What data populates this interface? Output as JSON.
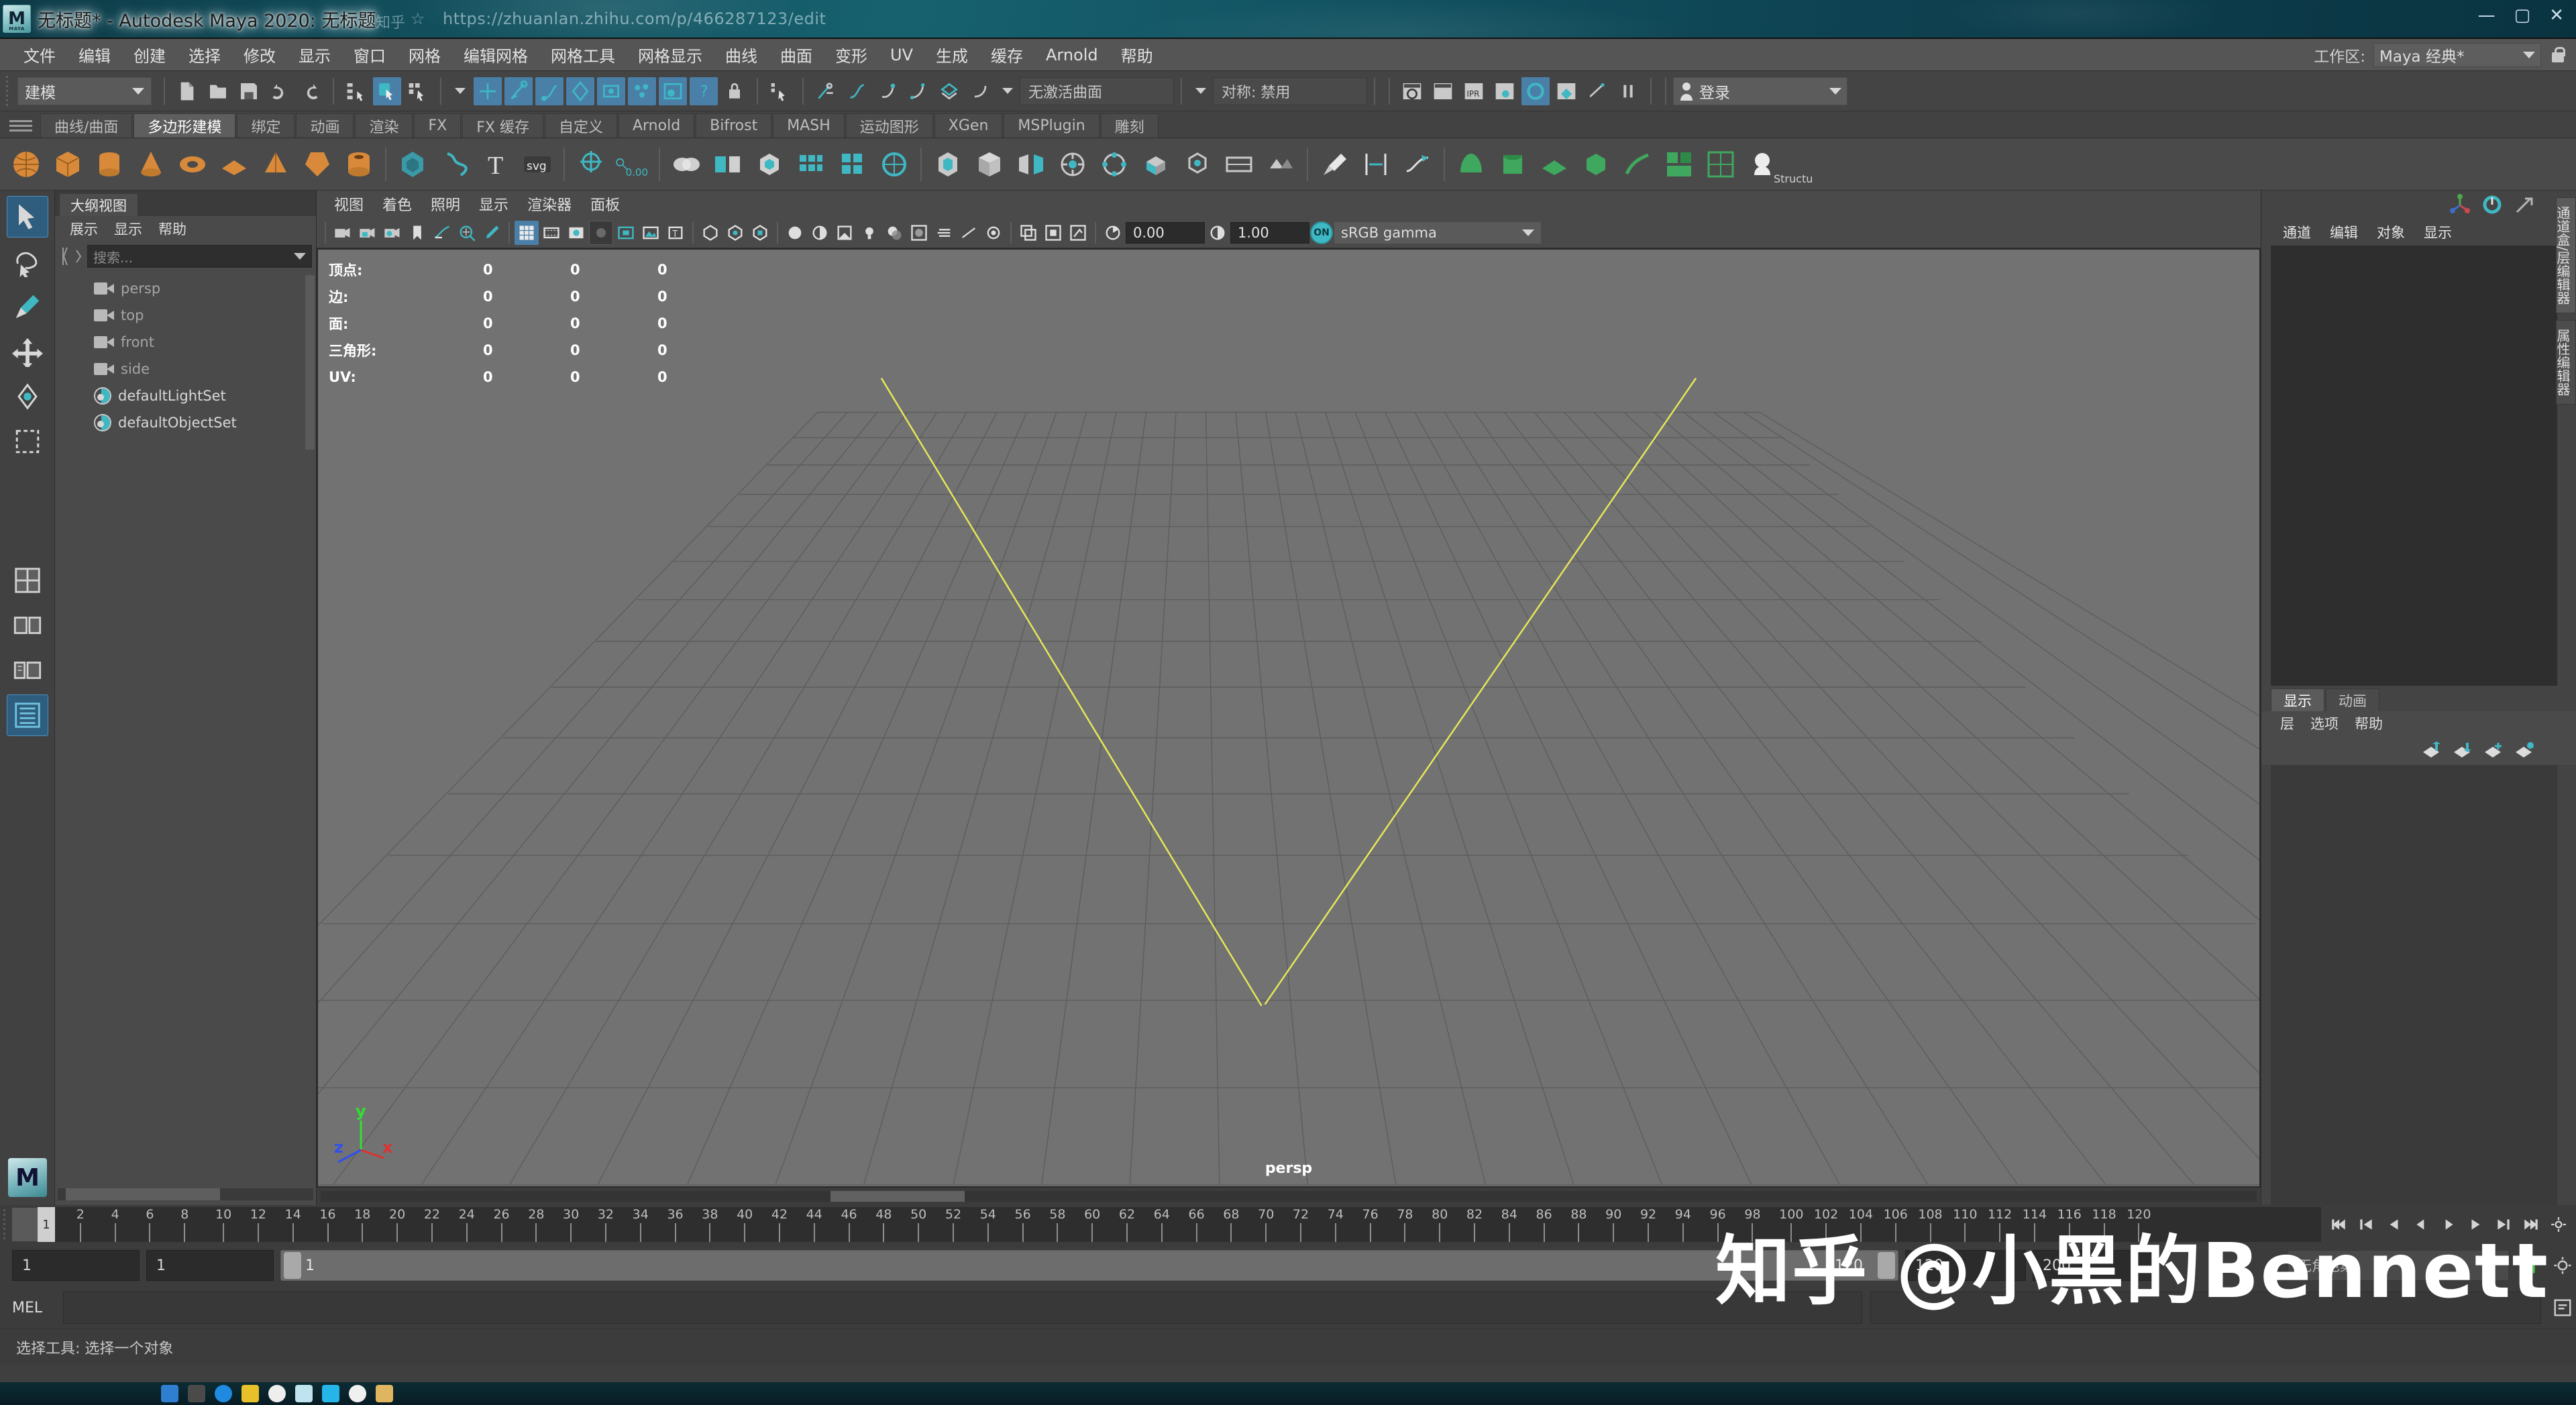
{
  "window": {
    "title": "无标题* - Autodesk Maya 2020: 无标题",
    "logo_text": "M",
    "logo_sub": "MAYA"
  },
  "background_browser": {
    "zhihu_label": "知乎",
    "star_icon": "☆",
    "url": "https://zhuanlan.zhihu.com/p/466287123/edit",
    "minimize": "—",
    "maximize": "▢",
    "close": "✕"
  },
  "menubar": {
    "items": [
      "文件",
      "编辑",
      "创建",
      "选择",
      "修改",
      "显示",
      "窗口",
      "网格",
      "编辑网格",
      "网格工具",
      "网格显示",
      "曲线",
      "曲面",
      "变形",
      "UV",
      "生成",
      "缓存",
      "Arnold",
      "帮助"
    ],
    "workspace_label": "工作区:",
    "workspace_value": "Maya 经典*"
  },
  "statusbar": {
    "mode": "建模",
    "active_surface": "无激活曲面",
    "symmetry": "对称: 禁用",
    "login": "登录"
  },
  "shelf": {
    "tabs": [
      "曲线/曲面",
      "多边形建模",
      "绑定",
      "动画",
      "渲染",
      "FX",
      "FX 缓存",
      "自定义",
      "Arnold",
      "Bifrost",
      "MASH",
      "运动图形",
      "XGen",
      "MSPlugin",
      "雕刻"
    ],
    "active_tab": "多边形建模",
    "text_tool_label": "T",
    "svg_tool_label": "svg",
    "snap_value": "0.00",
    "struct_label": "Structu"
  },
  "outliner": {
    "tab_title": "大纲视图",
    "menus": [
      "展示",
      "显示",
      "帮助"
    ],
    "search_placeholder": "搜索...",
    "items": [
      {
        "name": "persp",
        "type": "camera"
      },
      {
        "name": "top",
        "type": "camera"
      },
      {
        "name": "front",
        "type": "camera"
      },
      {
        "name": "side",
        "type": "camera"
      },
      {
        "name": "defaultLightSet",
        "type": "set"
      },
      {
        "name": "defaultObjectSet",
        "type": "set"
      }
    ]
  },
  "viewport": {
    "menus": [
      "视图",
      "着色",
      "照明",
      "显示",
      "渲染器",
      "面板"
    ],
    "exposure": "0.00",
    "gamma": "1.00",
    "on_badge": "ON",
    "color_space": "sRGB gamma",
    "camera_label": "persp",
    "axis": {
      "x": "x",
      "y": "y",
      "z": "z",
      "x_color": "#e03030",
      "y_color": "#30e030",
      "z_color": "#3050ee"
    },
    "hud": {
      "rows": [
        {
          "label": "顶点:",
          "v1": "0",
          "v2": "0",
          "v3": "0"
        },
        {
          "label": "边:",
          "v1": "0",
          "v2": "0",
          "v3": "0"
        },
        {
          "label": "面:",
          "v1": "0",
          "v2": "0",
          "v3": "0"
        },
        {
          "label": "三角形:",
          "v1": "0",
          "v2": "0",
          "v3": "0"
        },
        {
          "label": "UV:",
          "v1": "0",
          "v2": "0",
          "v3": "0"
        }
      ]
    },
    "grid_axis_color": "#e8e85a",
    "bg_color": "#727272"
  },
  "channel_box": {
    "menus": [
      "通道",
      "编辑",
      "对象",
      "显示"
    ],
    "vtabs": [
      "通道盒/层编辑器",
      "属性编辑器"
    ]
  },
  "layer_editor": {
    "tabs": [
      "显示",
      "动画"
    ],
    "active_tab": "显示",
    "menus": [
      "层",
      "选项",
      "帮助"
    ]
  },
  "timeline": {
    "current_frame": "1",
    "tick_labels": [
      "2",
      "4",
      "6",
      "8",
      "10",
      "12",
      "14",
      "16",
      "18",
      "20",
      "22",
      "24",
      "26",
      "28",
      "30",
      "32",
      "34",
      "36",
      "38",
      "40",
      "42",
      "44",
      "46",
      "48",
      "50",
      "52",
      "54",
      "56",
      "58",
      "60",
      "62",
      "64",
      "66",
      "68",
      "70",
      "72",
      "74",
      "76",
      "78",
      "80",
      "82",
      "84",
      "86",
      "88",
      "90",
      "92",
      "94",
      "96",
      "98",
      "100",
      "102",
      "104",
      "106",
      "108",
      "110",
      "112",
      "114",
      "116",
      "118",
      "120"
    ]
  },
  "range": {
    "start_field": "1",
    "anim_start_field": "1",
    "slider_start": "1",
    "slider_end": "120",
    "end_field": "120",
    "anim_end_field": "200",
    "character_set": "无角色集"
  },
  "command_line": {
    "language": "MEL",
    "input_value": ""
  },
  "status": {
    "message": "选择工具: 选择一个对象"
  },
  "watermark": {
    "text": "知乎 @小黑的Bennett"
  }
}
